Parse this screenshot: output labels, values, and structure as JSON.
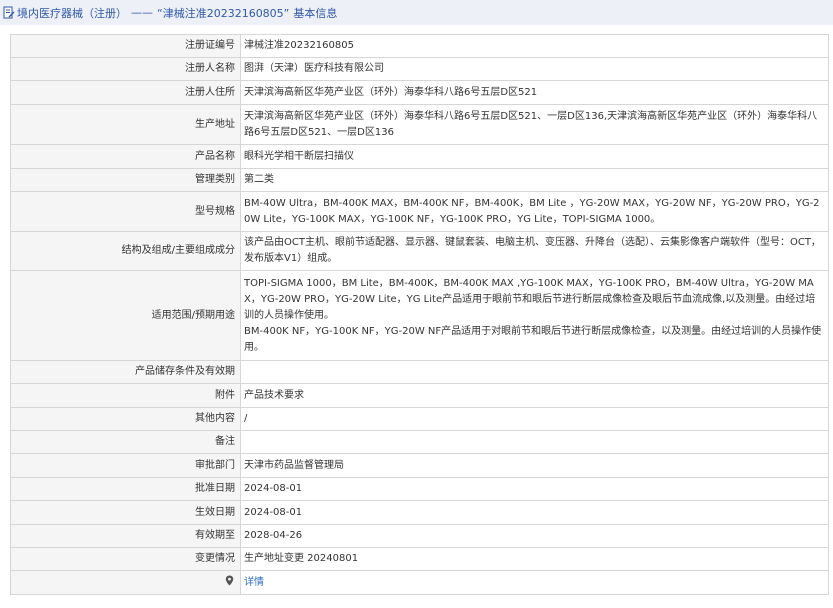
{
  "header": {
    "title": "境内医疗器械（注册）",
    "separator": "——",
    "record_quote": "“津械注准20232160805”",
    "suffix": "基本信息",
    "icon": "edit-document-icon"
  },
  "rows": [
    {
      "label": "注册证编号",
      "value": "津械注准20232160805"
    },
    {
      "label": "注册人名称",
      "value": "图湃（天津）医疗科技有限公司"
    },
    {
      "label": "注册人住所",
      "value": "天津滨海高新区华苑产业区（环外）海泰华科八路6号五层D区521"
    },
    {
      "label": "生产地址",
      "value": "天津滨海高新区华苑产业区（环外）海泰华科八路6号五层D区521、一层D区136,天津滨海高新区华苑产业区（环外）海泰华科八路6号五层D区521、一层D区136"
    },
    {
      "label": "产品名称",
      "value": "眼科光学相干断层扫描仪"
    },
    {
      "label": "管理类别",
      "value": "第二类"
    },
    {
      "label": "型号规格",
      "value": "BM-40W Ultra，BM-400K MAX，BM-400K NF，BM-400K，BM Lite ，YG-20W MAX，YG-20W NF，YG-20W PRO，YG-20W Lite，YG-100K MAX，YG-100K NF，YG-100K PRO，YG Lite，TOPI-SIGMA 1000。"
    },
    {
      "label": "结构及组成/主要组成成分",
      "value": "该产品由OCT主机、眼前节适配器、显示器、键鼠套装、电脑主机、变压器、升降台（选配）、云集影像客户端软件（型号：OCT，发布版本V1）组成。"
    },
    {
      "label": "适用范围/预期用途",
      "value": "TOPI-SIGMA 1000，BM Lite，BM-400K，BM-400K MAX ,YG-100K MAX，YG-100K PRO，BM-40W Ultra，YG-20W MAX，YG-20W PRO，YG-20W Lite，YG Lite产品适用于眼前节和眼后节进行断层成像检查及眼后节血流成像,以及测量。由经过培训的人员操作使用。\nBM-400K NF，YG-100K NF，YG-20W NF产品适用于对眼前节和眼后节进行断层成像检查，以及测量。由经过培训的人员操作使用。"
    },
    {
      "label": "产品储存条件及有效期",
      "value": ""
    },
    {
      "label": "附件",
      "value": "产品技术要求"
    },
    {
      "label": "其他内容",
      "value": "/"
    },
    {
      "label": "备注",
      "value": ""
    },
    {
      "label": "审批部门",
      "value": "天津市药品监督管理局"
    },
    {
      "label": "批准日期",
      "value": "2024-08-01"
    },
    {
      "label": "生效日期",
      "value": "2024-08-01"
    },
    {
      "label": "有效期至",
      "value": "2028-04-26"
    },
    {
      "label": "变更情况",
      "value": "生产地址变更 20240801"
    }
  ],
  "footer_row": {
    "icon": "location-pin-icon",
    "link_label": "详情"
  }
}
